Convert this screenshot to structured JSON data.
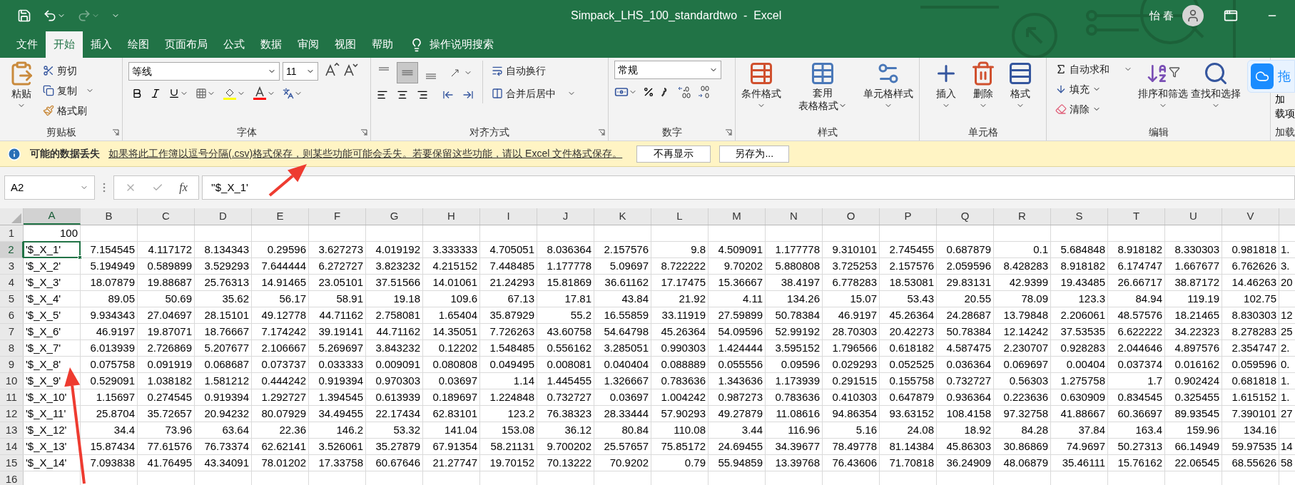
{
  "window": {
    "title": "Simpack_LHS_100_standardtwo  -  Excel",
    "user": "怡 春"
  },
  "ribbon_tabs": [
    {
      "label": "文件",
      "selected": false
    },
    {
      "label": "开始",
      "selected": true
    },
    {
      "label": "插入",
      "selected": false
    },
    {
      "label": "绘图",
      "selected": false
    },
    {
      "label": "页面布局",
      "selected": false
    },
    {
      "label": "公式",
      "selected": false
    },
    {
      "label": "数据",
      "selected": false
    },
    {
      "label": "审阅",
      "selected": false
    },
    {
      "label": "视图",
      "selected": false
    },
    {
      "label": "帮助",
      "selected": false
    }
  ],
  "tell_me": "操作说明搜索",
  "clipboard": {
    "paste": "粘贴",
    "cut": "剪切",
    "copy": "复制",
    "format_painter": "格式刷",
    "title": "剪贴板"
  },
  "font": {
    "name": "等线",
    "size": "11",
    "title": "字体"
  },
  "alignment": {
    "wrap": "自动换行",
    "merge": "合并后居中",
    "title": "对齐方式"
  },
  "number": {
    "format": "常规",
    "title": "数字"
  },
  "styles": {
    "conditional": "条件格式",
    "table_format": [
      "套用",
      "表格格式"
    ],
    "cell_styles": "单元格样式",
    "title": "样式"
  },
  "cells": {
    "insert": "插入",
    "delete": "删除",
    "format": "格式",
    "title": "单元格"
  },
  "editing": {
    "autosum": "自动求和",
    "fill": "填充",
    "clear": "清除",
    "sort": "排序和筛选",
    "find": "查找和选择",
    "title": "编辑"
  },
  "addins": {
    "lines": [
      "加",
      "载项"
    ],
    "title": "加载"
  },
  "cloud_button": {
    "label": "拖"
  },
  "message_bar": {
    "title": "可能的数据丢失",
    "text": "如果将此工作簿以逗号分隔(.csv)格式保存，则某些功能可能会丢失。若要保留这些功能，请以 Excel 文件格式保存。",
    "buttons": [
      "不再显示",
      "另存为..."
    ]
  },
  "formula_bar": {
    "name_box": "A2",
    "fx": "fx",
    "formula": "''$_X_1'"
  },
  "grid": {
    "columns": [
      {
        "label": "A",
        "selected": true
      },
      {
        "label": "B",
        "selected": false
      },
      {
        "label": "C",
        "selected": false
      },
      {
        "label": "D",
        "selected": false
      },
      {
        "label": "E",
        "selected": false
      },
      {
        "label": "F",
        "selected": false
      },
      {
        "label": "G",
        "selected": false
      },
      {
        "label": "H",
        "selected": false
      },
      {
        "label": "I",
        "selected": false
      },
      {
        "label": "J",
        "selected": false
      },
      {
        "label": "K",
        "selected": false
      },
      {
        "label": "L",
        "selected": false
      },
      {
        "label": "M",
        "selected": false
      },
      {
        "label": "N",
        "selected": false
      },
      {
        "label": "O",
        "selected": false
      },
      {
        "label": "P",
        "selected": false
      },
      {
        "label": "Q",
        "selected": false
      },
      {
        "label": "R",
        "selected": false
      },
      {
        "label": "S",
        "selected": false
      },
      {
        "label": "T",
        "selected": false
      },
      {
        "label": "U",
        "selected": false
      },
      {
        "label": "V",
        "selected": false
      }
    ],
    "rows": [
      {
        "number": "1",
        "kind": "numeric",
        "selected": false,
        "label": "100",
        "values": []
      },
      {
        "number": "2",
        "kind": "named",
        "selected": true,
        "label": "'$_X_1'",
        "values": [
          "7.154545",
          "4.117172",
          "8.134343",
          "0.29596",
          "3.627273",
          "4.019192",
          "3.333333",
          "4.705051",
          "8.036364",
          "2.157576",
          "9.8",
          "4.509091",
          "1.177778",
          "9.310101",
          "2.745455",
          "0.687879",
          "0.1",
          "5.684848",
          "8.918182",
          "8.330303",
          "0.981818"
        ],
        "overflow": "1."
      },
      {
        "number": "3",
        "kind": "named",
        "selected": false,
        "label": "'$_X_2'",
        "values": [
          "5.194949",
          "0.589899",
          "3.529293",
          "7.644444",
          "6.272727",
          "3.823232",
          "4.215152",
          "7.448485",
          "1.177778",
          "5.09697",
          "8.722222",
          "9.70202",
          "5.880808",
          "3.725253",
          "2.157576",
          "2.059596",
          "8.428283",
          "8.918182",
          "6.174747",
          "1.667677",
          "6.762626"
        ],
        "overflow": "3."
      },
      {
        "number": "4",
        "kind": "named",
        "selected": false,
        "label": "'$_X_3'",
        "values": [
          "18.07879",
          "19.88687",
          "25.76313",
          "14.91465",
          "23.05101",
          "37.51566",
          "14.01061",
          "21.24293",
          "15.81869",
          "36.61162",
          "17.17475",
          "15.36667",
          "38.4197",
          "6.778283",
          "18.53081",
          "29.83131",
          "42.9399",
          "19.43485",
          "26.66717",
          "38.87172",
          "14.46263"
        ],
        "overflow": "20"
      },
      {
        "number": "5",
        "kind": "named",
        "selected": false,
        "label": "'$_X_4'",
        "values": [
          "89.05",
          "50.69",
          "35.62",
          "56.17",
          "58.91",
          "19.18",
          "109.6",
          "67.13",
          "17.81",
          "43.84",
          "21.92",
          "4.11",
          "134.26",
          "15.07",
          "53.43",
          "20.55",
          "78.09",
          "123.3",
          "84.94",
          "119.19",
          "102.75"
        ]
      },
      {
        "number": "6",
        "kind": "named",
        "selected": false,
        "label": "'$_X_5'",
        "values": [
          "9.934343",
          "27.04697",
          "28.15101",
          "49.12778",
          "44.71162",
          "2.758081",
          "1.65404",
          "35.87929",
          "55.2",
          "16.55859",
          "33.11919",
          "27.59899",
          "50.78384",
          "46.9197",
          "45.26364",
          "24.28687",
          "13.79848",
          "2.206061",
          "48.57576",
          "18.21465",
          "8.830303"
        ],
        "overflow": "12"
      },
      {
        "number": "7",
        "kind": "named",
        "selected": false,
        "label": "'$_X_6'",
        "values": [
          "46.9197",
          "19.87071",
          "18.76667",
          "7.174242",
          "39.19141",
          "44.71162",
          "14.35051",
          "7.726263",
          "43.60758",
          "54.64798",
          "45.26364",
          "54.09596",
          "52.99192",
          "28.70303",
          "20.42273",
          "50.78384",
          "12.14242",
          "37.53535",
          "6.622222",
          "34.22323",
          "8.278283"
        ],
        "overflow": "25"
      },
      {
        "number": "8",
        "kind": "named",
        "selected": false,
        "label": "'$_X_7'",
        "values": [
          "6.013939",
          "2.726869",
          "5.207677",
          "2.106667",
          "5.269697",
          "3.843232",
          "0.12202",
          "1.548485",
          "0.556162",
          "3.285051",
          "0.990303",
          "1.424444",
          "3.595152",
          "1.796566",
          "0.618182",
          "4.587475",
          "2.230707",
          "0.928283",
          "2.044646",
          "4.897576",
          "2.354747"
        ],
        "overflow": "2."
      },
      {
        "number": "9",
        "kind": "named",
        "selected": false,
        "label": "'$_X_8'",
        "values": [
          "0.075758",
          "0.091919",
          "0.068687",
          "0.073737",
          "0.033333",
          "0.009091",
          "0.080808",
          "0.049495",
          "0.008081",
          "0.040404",
          "0.088889",
          "0.055556",
          "0.09596",
          "0.029293",
          "0.052525",
          "0.036364",
          "0.069697",
          "0.00404",
          "0.037374",
          "0.016162",
          "0.059596"
        ],
        "overflow": "0."
      },
      {
        "number": "10",
        "kind": "named",
        "selected": false,
        "label": "'$_X_9'",
        "values": [
          "0.529091",
          "1.038182",
          "1.581212",
          "0.444242",
          "0.919394",
          "0.970303",
          "0.03697",
          "1.14",
          "1.445455",
          "1.326667",
          "0.783636",
          "1.343636",
          "1.173939",
          "0.291515",
          "0.155758",
          "0.732727",
          "0.56303",
          "1.275758",
          "1.7",
          "0.902424",
          "0.681818"
        ],
        "overflow": "1."
      },
      {
        "number": "11",
        "kind": "named",
        "selected": false,
        "label": "'$_X_10'",
        "values": [
          "1.15697",
          "0.274545",
          "0.919394",
          "1.292727",
          "1.394545",
          "0.613939",
          "0.189697",
          "1.224848",
          "0.732727",
          "0.03697",
          "1.004242",
          "0.987273",
          "0.783636",
          "0.410303",
          "0.647879",
          "0.936364",
          "0.223636",
          "0.630909",
          "0.834545",
          "0.325455",
          "1.615152"
        ],
        "overflow": "1."
      },
      {
        "number": "12",
        "kind": "named",
        "selected": false,
        "label": "'$_X_11'",
        "values": [
          "25.8704",
          "35.72657",
          "20.94232",
          "80.07929",
          "34.49455",
          "22.17434",
          "62.83101",
          "123.2",
          "76.38323",
          "28.33444",
          "57.90293",
          "49.27879",
          "11.08616",
          "94.86354",
          "93.63152",
          "108.4158",
          "97.32758",
          "41.88667",
          "60.36697",
          "89.93545",
          "7.390101"
        ],
        "overflow": "27"
      },
      {
        "number": "13",
        "kind": "named",
        "selected": false,
        "label": "'$_X_12'",
        "values": [
          "34.4",
          "73.96",
          "63.64",
          "22.36",
          "146.2",
          "53.32",
          "141.04",
          "153.08",
          "36.12",
          "80.84",
          "110.08",
          "3.44",
          "116.96",
          "5.16",
          "24.08",
          "18.92",
          "84.28",
          "37.84",
          "163.4",
          "159.96",
          "134.16"
        ]
      },
      {
        "number": "14",
        "kind": "named",
        "selected": false,
        "label": "'$_X_13'",
        "values": [
          "15.87434",
          "77.61576",
          "76.73374",
          "62.62141",
          "3.526061",
          "35.27879",
          "67.91354",
          "58.21131",
          "9.700202",
          "25.57657",
          "75.85172",
          "24.69455",
          "34.39677",
          "78.49778",
          "81.14384",
          "45.86303",
          "30.86869",
          "74.9697",
          "50.27313",
          "66.14949",
          "59.97535"
        ],
        "overflow": "14"
      },
      {
        "number": "15",
        "kind": "named",
        "selected": false,
        "label": "'$_X_14'",
        "values": [
          "7.093838",
          "41.76495",
          "43.34091",
          "78.01202",
          "17.33758",
          "60.67646",
          "21.27747",
          "19.70152",
          "70.13222",
          "70.9202",
          "0.79",
          "55.94859",
          "13.39768",
          "76.43606",
          "71.70818",
          "36.24909",
          "48.06879",
          "35.46111",
          "15.76162",
          "22.06545",
          "68.55626"
        ],
        "overflow": "58"
      },
      {
        "number": "16",
        "kind": "empty",
        "selected": false,
        "values": []
      }
    ]
  },
  "annotations": [
    {
      "kind": "arrow"
    },
    {
      "kind": "arrow"
    }
  ]
}
